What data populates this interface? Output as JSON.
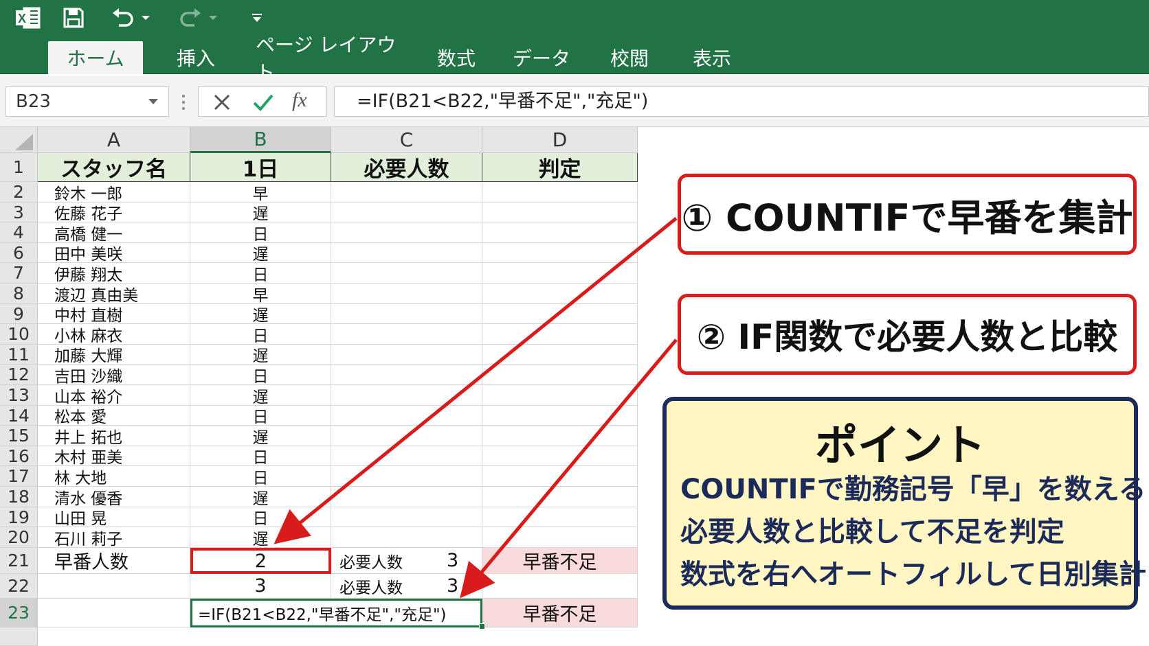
{
  "ribbon": {
    "tabs": [
      {
        "label": "ホーム",
        "active": true
      },
      {
        "label": "挿入"
      },
      {
        "label": "ページ レイアウト"
      },
      {
        "label": "数式"
      },
      {
        "label": "データ"
      },
      {
        "label": "校閲"
      },
      {
        "label": "表示"
      }
    ],
    "quick_access_icons": [
      "excel-logo-icon",
      "save-icon",
      "undo-icon",
      "redo-icon",
      "customize-icon"
    ]
  },
  "formula_bar": {
    "name_box": "B23",
    "formula": "=IF(B21<B22,\"早番不足\",\"充足\")",
    "fx_label": "fx"
  },
  "sheet": {
    "columns": [
      "A",
      "B",
      "C",
      "D"
    ],
    "header_row": {
      "row": "1",
      "A": "スタッフ名",
      "B": "1日",
      "C": "必要人数",
      "D": "判定"
    },
    "rows": [
      {
        "row": "2",
        "name": "鈴木 一郎",
        "shift": "早"
      },
      {
        "row": "3",
        "name": "佐藤 花子",
        "shift": "遅"
      },
      {
        "row": "4",
        "name": "高橋 健一",
        "shift": "日"
      },
      {
        "row": "6",
        "name": "田中 美咲",
        "shift": "遅"
      },
      {
        "row": "7",
        "name": "伊藤 翔太",
        "shift": "日"
      },
      {
        "row": "8",
        "name": "渡辺 真由美",
        "shift": "早"
      },
      {
        "row": "9",
        "name": "中村 直樹",
        "shift": "遅"
      },
      {
        "row": "10",
        "name": "小林 麻衣",
        "shift": "日"
      },
      {
        "row": "11",
        "name": "加藤 大輝",
        "shift": "遅"
      },
      {
        "row": "12",
        "name": "吉田 沙織",
        "shift": "日"
      },
      {
        "row": "13",
        "name": "山本 裕介",
        "shift": "遅"
      },
      {
        "row": "14",
        "name": "松本 愛",
        "shift": "日"
      },
      {
        "row": "15",
        "name": "井上 拓也",
        "shift": "遅"
      },
      {
        "row": "16",
        "name": "木村 亜美",
        "shift": "日"
      },
      {
        "row": "17",
        "name": "林 大地",
        "shift": "日"
      },
      {
        "row": "18",
        "name": "清水 優香",
        "shift": "遅"
      },
      {
        "row": "19",
        "name": "山田 晃",
        "shift": "日"
      },
      {
        "row": "20",
        "name": "石川 莉子",
        "shift": "遅"
      }
    ],
    "row21": {
      "row": "21",
      "A": "早番人数",
      "B": "2",
      "C_label": "必要人数",
      "C_value": "3",
      "D": "早番不足"
    },
    "row22": {
      "row": "22",
      "B": "3",
      "C_label": "必要人数",
      "C_value": "3"
    },
    "row23": {
      "row": "23",
      "B": "=IF(B21<B22,\"早番不足\",\"充足\")",
      "D": "早番不足"
    }
  },
  "callouts": {
    "step1": "① COUNTIFで早番を集計",
    "step2": "② IF関数で必要人数と比較",
    "point_title": "ポイント",
    "point_lines": [
      "COUNTIFで勤務記号「早」を数える",
      "必要人数と比較して不足を判定",
      "数式を右へオートフィルして日別集計"
    ]
  },
  "colors": {
    "ribbon_green": "#217346",
    "header_fill": "#e2efda",
    "alert_fill": "#fadbdb",
    "callout_red": "#d81b1b",
    "point_fill": "#fff6c4",
    "point_border": "#1c2a5a"
  }
}
